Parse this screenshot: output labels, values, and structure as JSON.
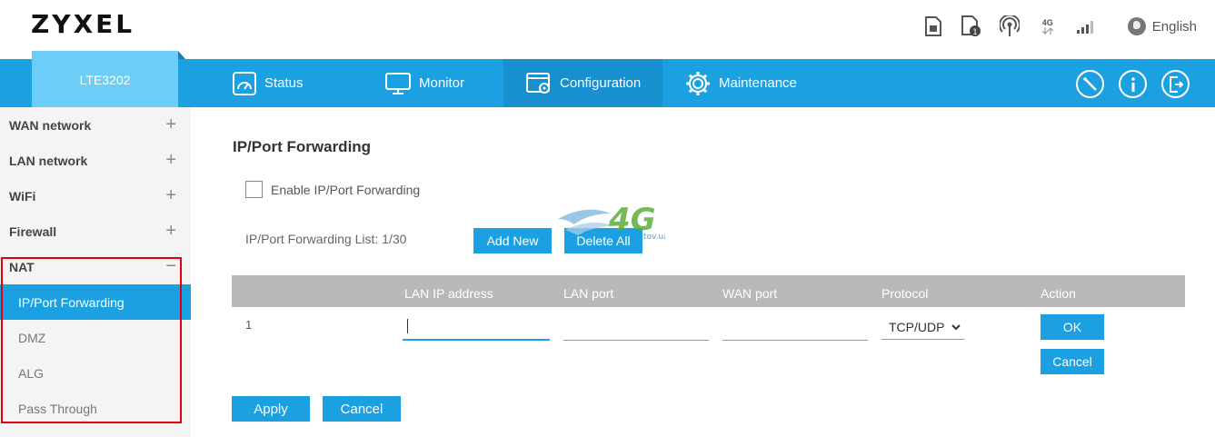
{
  "brand": {
    "logo": "ZYXEL"
  },
  "header": {
    "language": "English",
    "network_badge": "4G",
    "sim_count": "1"
  },
  "nav": {
    "model": "LTE3202",
    "items": [
      {
        "label": "Status",
        "icon": "status-icon"
      },
      {
        "label": "Monitor",
        "icon": "monitor-icon"
      },
      {
        "label": "Configuration",
        "icon": "configuration-icon",
        "active": true
      },
      {
        "label": "Maintenance",
        "icon": "gear-icon"
      }
    ],
    "right_icons": [
      "wizard-icon",
      "info-icon",
      "logout-icon"
    ]
  },
  "sidebar": {
    "groups": [
      {
        "label": "WAN network",
        "toggle": "+"
      },
      {
        "label": "LAN network",
        "toggle": "+"
      },
      {
        "label": "WiFi",
        "toggle": "+"
      },
      {
        "label": "Firewall",
        "toggle": "+"
      },
      {
        "label": "NAT",
        "toggle": "−"
      }
    ],
    "nat_items": [
      "IP/Port Forwarding",
      "DMZ",
      "ALG",
      "Pass Through"
    ]
  },
  "main": {
    "title": "IP/Port Forwarding",
    "enable_label": "Enable IP/Port Forwarding",
    "list_count": "IP/Port Forwarding List: 1/30",
    "add_new": "Add New",
    "delete_all": "Delete All",
    "columns": [
      "LAN IP address",
      "LAN port",
      "WAN port",
      "Protocol",
      "Action"
    ],
    "row": {
      "index": "1",
      "lan_ip": "",
      "lan_port": "",
      "wan_port": "",
      "protocol": "TCP/UDP",
      "ok": "OK",
      "cancel": "Cancel"
    },
    "apply": "Apply",
    "cancel": "Cancel"
  },
  "watermark": {
    "text": "4G",
    "sub": "tov.ua"
  },
  "colors": {
    "primary": "#1ba1e2",
    "model_tab": "#6ccdf7",
    "highlight": "#e0000f",
    "table_header": "#b9b9b9"
  }
}
